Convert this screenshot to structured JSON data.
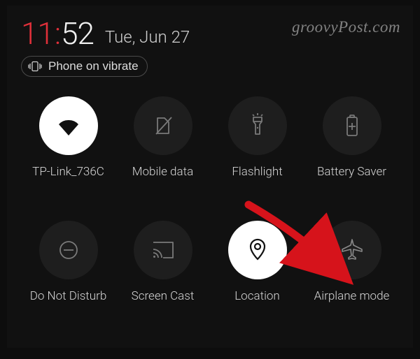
{
  "watermark": "groovyPost.com",
  "clock": {
    "hour": "11",
    "colon": ":",
    "minute": "52"
  },
  "date": "Tue, Jun 27",
  "chip": {
    "label": "Phone on vibrate"
  },
  "tiles": [
    {
      "id": "wifi",
      "label": "TP-Link_736C",
      "icon": "wifi-icon",
      "active": true
    },
    {
      "id": "mobile-data",
      "label": "Mobile data",
      "icon": "no-sim-icon",
      "active": false
    },
    {
      "id": "flashlight",
      "label": "Flashlight",
      "icon": "flashlight-icon",
      "active": false
    },
    {
      "id": "battery-saver",
      "label": "Battery Saver",
      "icon": "battery-plus-icon",
      "active": false
    },
    {
      "id": "dnd",
      "label": "Do Not Disturb",
      "icon": "dnd-icon",
      "active": false
    },
    {
      "id": "screen-cast",
      "label": "Screen Cast",
      "icon": "cast-icon",
      "active": false
    },
    {
      "id": "location",
      "label": "Location",
      "icon": "location-icon",
      "active": true
    },
    {
      "id": "airplane",
      "label": "Airplane mode",
      "icon": "airplane-icon",
      "active": false
    }
  ],
  "annotation": {
    "type": "arrow",
    "color": "#d6131b",
    "target": "airplane"
  }
}
